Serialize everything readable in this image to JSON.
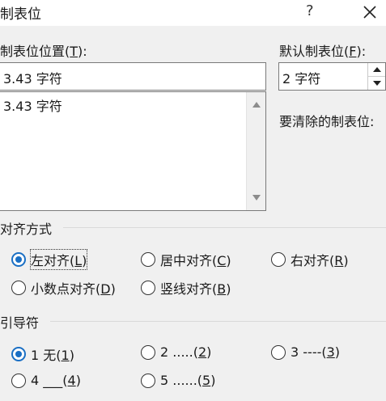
{
  "dialog": {
    "title": "制表位",
    "help": "?",
    "close": "✕"
  },
  "tab_stop": {
    "label_pre": "制表位位置(",
    "label_key": "T",
    "label_post": "):",
    "value": "3.43 字符",
    "list_items": [
      "3.43 字符"
    ]
  },
  "default_tab": {
    "label_pre": "默认制表位(",
    "label_key": "F",
    "label_post": "):",
    "value": "2 字符"
  },
  "clear_label": "要清除的制表位:",
  "alignment": {
    "title": "对齐方式",
    "options": [
      {
        "pre": "左对齐(",
        "key": "L",
        "post": ")",
        "selected": true
      },
      {
        "pre": "居中对齐(",
        "key": "C",
        "post": ")",
        "selected": false
      },
      {
        "pre": "右对齐(",
        "key": "R",
        "post": ")",
        "selected": false
      },
      {
        "pre": "小数点对齐(",
        "key": "D",
        "post": ")",
        "selected": false
      },
      {
        "pre": "竖线对齐(",
        "key": "B",
        "post": ")",
        "selected": false
      }
    ]
  },
  "leader": {
    "title": "引导符",
    "options": [
      {
        "pre": "1 无(",
        "key": "1",
        "post": ")",
        "selected": true
      },
      {
        "pre": "2 .....(",
        "key": "2",
        "post": ")",
        "selected": false
      },
      {
        "pre": "3 ----(",
        "key": "3",
        "post": ")",
        "selected": false
      },
      {
        "pre": "4 ___(",
        "key": "4",
        "post": ")",
        "selected": false
      },
      {
        "pre": "5 ......(",
        "key": "5",
        "post": ")",
        "selected": false
      }
    ]
  },
  "colors": {
    "accent": "#1a6fc4",
    "background": "#f0f0f0"
  }
}
